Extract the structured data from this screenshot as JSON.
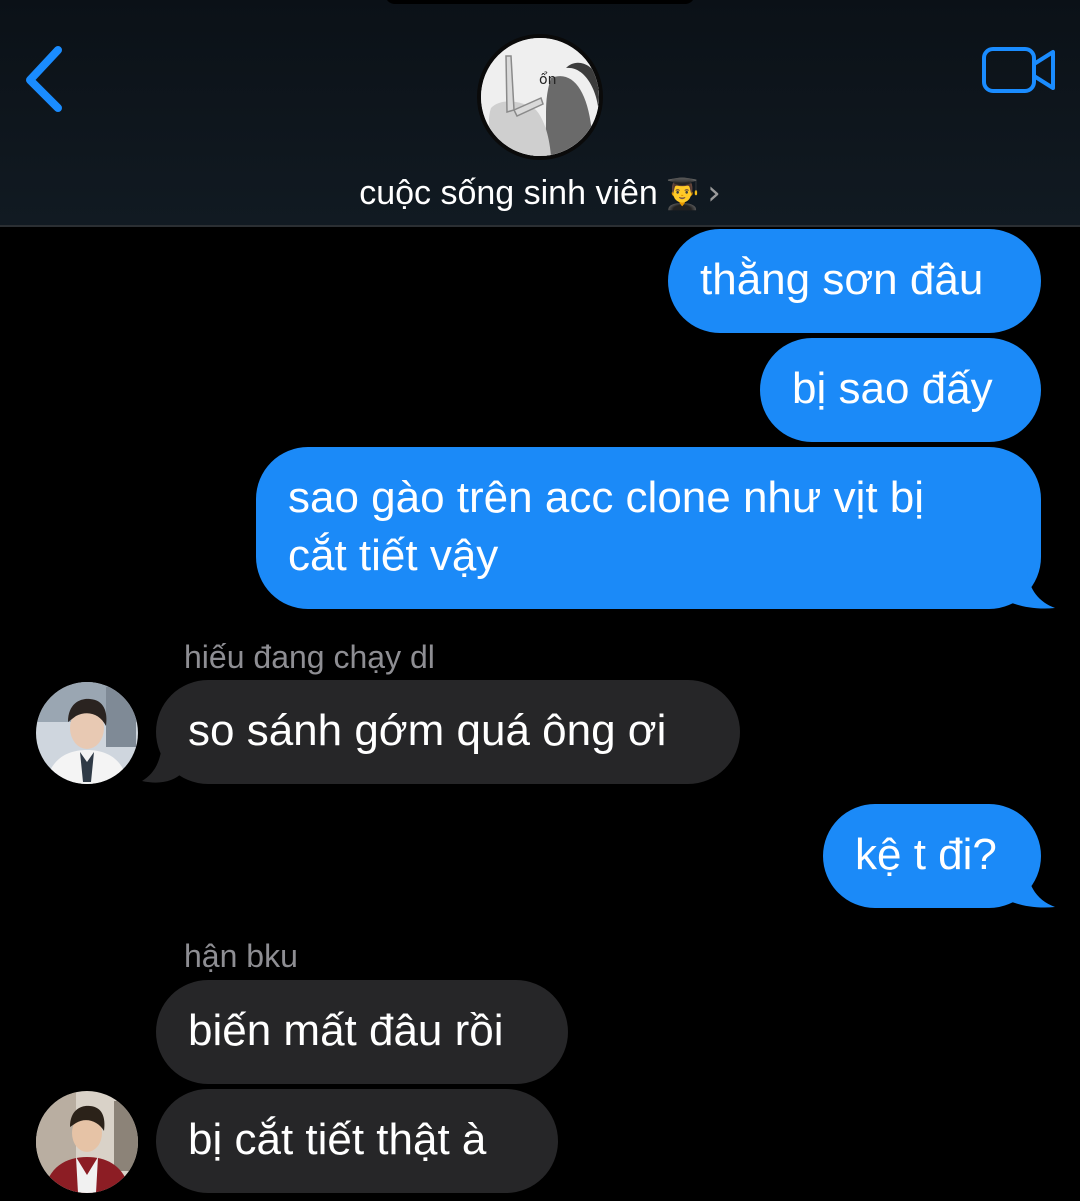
{
  "header": {
    "group_name": "cuộc sống sinh viên",
    "group_emoji": "👨‍🎓",
    "chevron": "›",
    "avatar_text": "ổn",
    "back_icon": "chevron-left-icon",
    "video_icon": "video-camera-icon"
  },
  "colors": {
    "outgoing_bubble": "#1b8af8",
    "incoming_bubble": "#262628",
    "accent": "#1a8cff",
    "background": "#000000"
  },
  "messages": [
    {
      "direction": "outgoing",
      "text": "thằng sơn đâu"
    },
    {
      "direction": "outgoing",
      "text": "bị sao đấy"
    },
    {
      "direction": "outgoing",
      "line1": "sao gào trên acc clone như vịt bị",
      "line2": "cắt tiết vậy"
    },
    {
      "direction": "incoming",
      "sender": "hiếu đang chạy dl",
      "text": "so sánh gớm quá ông ơi"
    },
    {
      "direction": "outgoing",
      "text": "kệ t đi?"
    },
    {
      "direction": "incoming",
      "sender": "hận bku",
      "text": "biến mất đâu rồi"
    },
    {
      "direction": "incoming",
      "text": "bị cắt tiết thật à"
    }
  ]
}
